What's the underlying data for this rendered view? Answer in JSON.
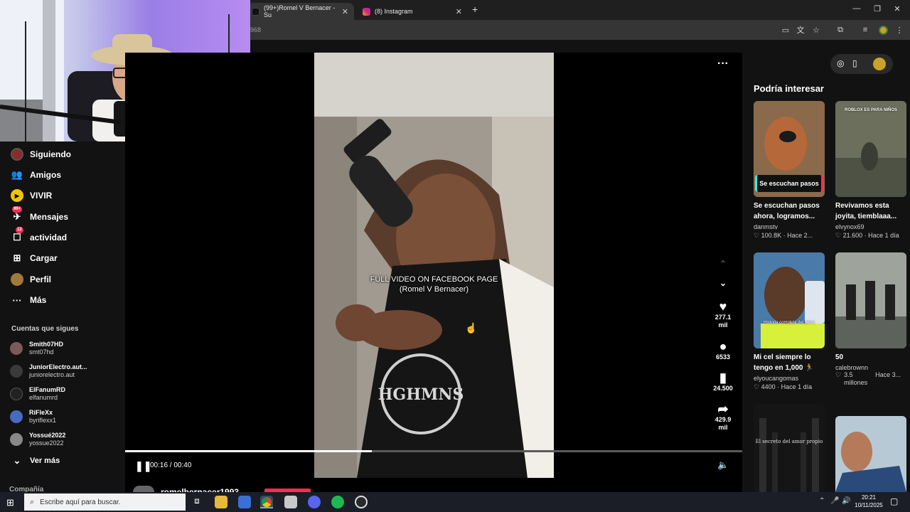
{
  "browser": {
    "tabs": [
      {
        "title": "(99+)Romel V Bernacer - Su",
        "active": true
      },
      {
        "title": "(8) Instagram",
        "active": false
      }
    ],
    "new_tab": "+",
    "url": "968",
    "window_controls": {
      "minimize": "—",
      "restore": "❐",
      "close": "✕"
    }
  },
  "sidebar": {
    "items": [
      {
        "label": "Siguiendo",
        "icon": "following-icon"
      },
      {
        "label": "Amigos",
        "icon": "friends-icon"
      },
      {
        "label": "VIVIR",
        "icon": "live-icon"
      },
      {
        "label": "Mensajes",
        "icon": "messages-icon",
        "badge": "99+"
      },
      {
        "label": "actividad",
        "icon": "activity-icon",
        "badge": "12"
      },
      {
        "label": "Cargar",
        "icon": "upload-icon"
      },
      {
        "label": "Perfil",
        "icon": "profile-icon"
      },
      {
        "label": "Más",
        "icon": "more-icon"
      }
    ],
    "following_header": "Cuentas que sigues",
    "accounts": [
      {
        "name": "Smith07HD",
        "handle": "smt07hd"
      },
      {
        "name": "JuniorElectro.aut...",
        "handle": "juniorelectro.aut"
      },
      {
        "name": "ElFanumRD",
        "handle": "elfanumrd"
      },
      {
        "name": "RiFleXx",
        "handle": "byriflexx1"
      },
      {
        "name": "Yossué2022",
        "handle": "yossue2022"
      }
    ],
    "see_more": "Ver más",
    "footer": "Compañía"
  },
  "video": {
    "caption_line1": "FULL VIDEO ON FACEBOOK PAGE",
    "caption_line2": "(Romel V Bernacer)",
    "time": "00:16 / 00:40",
    "progress": 0.4,
    "likes": [
      "277.1",
      "mil"
    ],
    "comments": "6533",
    "saves": "24.500",
    "shares": [
      "429.9",
      "mil"
    ],
    "author": "romelbernacer1993"
  },
  "recommendations": {
    "title": "Podría interesar",
    "items": [
      {
        "overlay": "Se escuchan pasos",
        "title": [
          "Se escuchan pasos",
          "ahora, logramos..."
        ],
        "user": "danmstv",
        "likes": "100.8K",
        "time": "Hace 2..."
      },
      {
        "overlay": "ROBLOX ES PARA NIÑOS",
        "title": [
          "Revivamos esta",
          "joyita, tiemblaaa..."
        ],
        "user": "elvynox69",
        "likes": "21.600",
        "time": "Hace 1 día"
      },
      {
        "overlay": "Historia completa del perro",
        "title": [
          "Mi cel siempre lo",
          "tengo en 1,000 🏃"
        ],
        "user": "elyoucangomas",
        "likes": "4400",
        "time": "Hace 1 día"
      },
      {
        "overlay": "",
        "title": [
          "50",
          ""
        ],
        "user": "calebrownn",
        "likes": "3.5 millones",
        "time": "Hace 3..."
      },
      {
        "overlay": "El secreto del amor propio",
        "title": [
          "",
          ""
        ],
        "user": "",
        "likes": "",
        "time": ""
      }
    ]
  },
  "taskbar": {
    "search_placeholder": "Escribe aquí para buscar.",
    "time": "20:21",
    "date": "10/11/2025"
  },
  "colors": {
    "accent": "#fe2c55",
    "badge": "#fe2c55"
  }
}
